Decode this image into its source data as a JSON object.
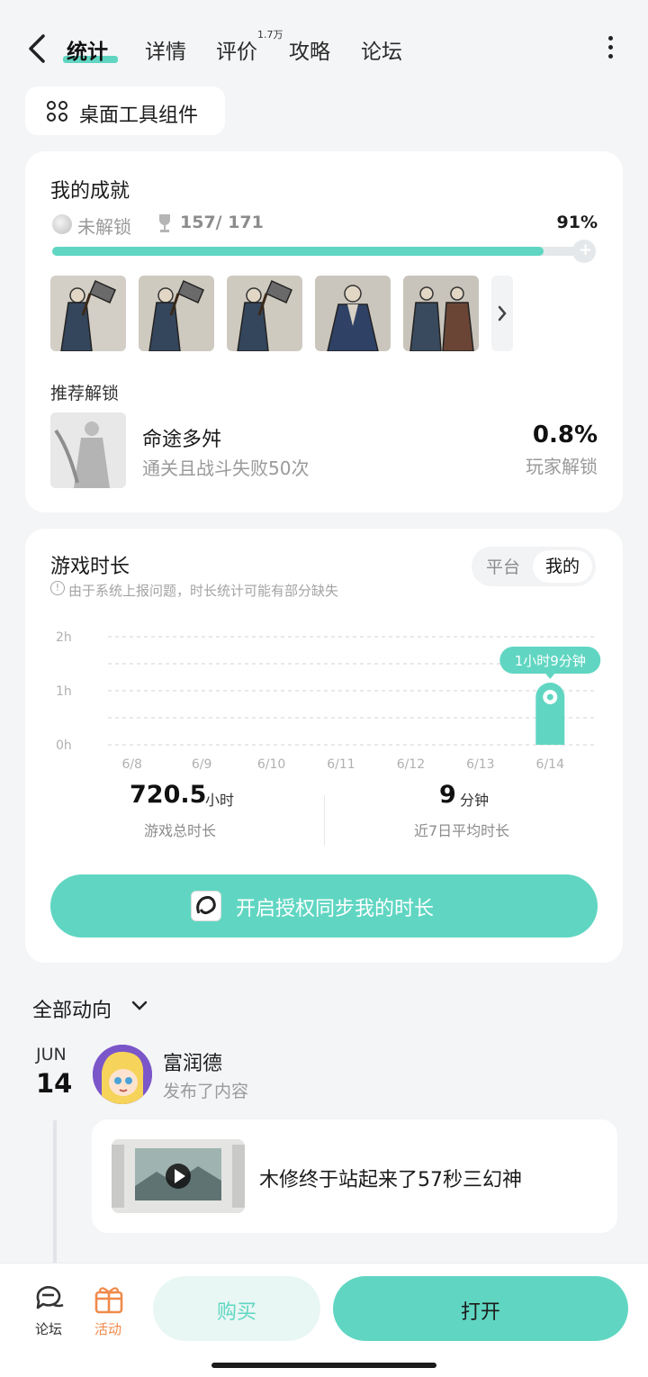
{
  "nav": {
    "tabs": [
      {
        "label": "统计",
        "active": true
      },
      {
        "label": "详情"
      },
      {
        "label": "评价",
        "badge": "1.7万"
      },
      {
        "label": "攻略"
      },
      {
        "label": "论坛"
      }
    ]
  },
  "widget": {
    "label": "桌面工具组件"
  },
  "achievements": {
    "title": "我的成就",
    "locked_label": "未解锁",
    "count": "157/ 171",
    "percent": "91%",
    "progress": 0.91,
    "recommend_title": "推荐解锁",
    "recommend": {
      "name": "命途多舛",
      "desc": "通关且战斗失败50次",
      "rate": "0.8%",
      "rate_label": "玩家解锁"
    }
  },
  "playtime": {
    "title": "游戏时长",
    "note": "由于系统上报问题，时长统计可能有部分缺失",
    "segments": [
      "平台",
      "我的"
    ],
    "selected_segment": "我的",
    "total_value": "720.5",
    "total_unit": "小时",
    "total_label": "游戏总时长",
    "avg_value": "9",
    "avg_unit": "分钟",
    "avg_label": "近7日平均时长",
    "sync_label": "开启授权同步我的时长"
  },
  "chart_data": {
    "type": "bar",
    "categories": [
      "6/8",
      "6/9",
      "6/10",
      "6/11",
      "6/12",
      "6/13",
      "6/14"
    ],
    "values": [
      0,
      0,
      0,
      0,
      0,
      0,
      1.15
    ],
    "y_ticks": [
      "0h",
      "1h",
      "2h"
    ],
    "ylim": [
      0,
      2
    ],
    "highlight_label": "1小时9分钟",
    "grid": true,
    "colors": {
      "bar": "#60d6c2"
    }
  },
  "feed": {
    "filter_label": "全部动向",
    "month": "JUN",
    "day": "14",
    "user": "富润德",
    "action": "发布了内容",
    "post_text": "木修终于站起来了57秒三幻神"
  },
  "bottom": {
    "forum_label": "论坛",
    "activity_label": "活动",
    "buy_label": "购买",
    "open_label": "打开"
  },
  "colors": {
    "accent": "#60d6c2",
    "activity": "#f08a4b"
  }
}
